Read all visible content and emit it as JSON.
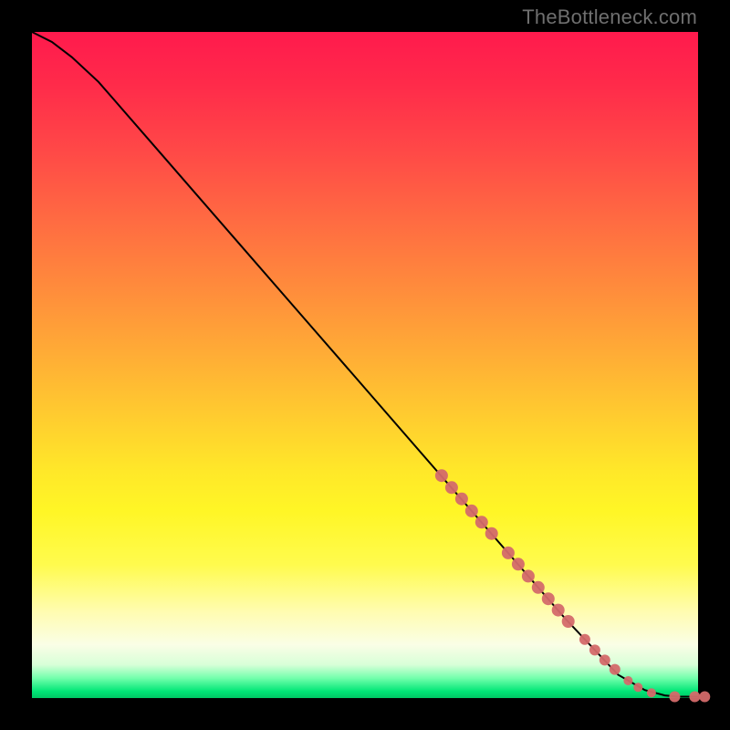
{
  "attribution": "TheBottleneck.com",
  "chart_data": {
    "type": "line",
    "title": "",
    "xlabel": "",
    "ylabel": "",
    "xlim": [
      0,
      100
    ],
    "ylim": [
      0,
      100
    ],
    "series": [
      {
        "name": "curve",
        "x": [
          0,
          3,
          6,
          10,
          20,
          30,
          40,
          50,
          60,
          70,
          80,
          88,
          92,
          95,
          97,
          100
        ],
        "y": [
          100,
          98.5,
          96.2,
          92.5,
          81,
          69.5,
          58,
          46.5,
          35,
          23.5,
          12,
          3.5,
          1.2,
          0.4,
          0.2,
          0.2
        ]
      }
    ],
    "markers": {
      "name": "data-points",
      "color": "#d46a6a",
      "points": [
        {
          "x": 61.5,
          "y": 33.4,
          "r": 7
        },
        {
          "x": 63.0,
          "y": 31.6,
          "r": 7
        },
        {
          "x": 64.5,
          "y": 29.9,
          "r": 7
        },
        {
          "x": 66.0,
          "y": 28.1,
          "r": 7
        },
        {
          "x": 67.5,
          "y": 26.4,
          "r": 7
        },
        {
          "x": 69.0,
          "y": 24.7,
          "r": 7
        },
        {
          "x": 71.5,
          "y": 21.8,
          "r": 7
        },
        {
          "x": 73.0,
          "y": 20.1,
          "r": 7
        },
        {
          "x": 74.5,
          "y": 18.3,
          "r": 7
        },
        {
          "x": 76.0,
          "y": 16.6,
          "r": 7
        },
        {
          "x": 77.5,
          "y": 14.9,
          "r": 7
        },
        {
          "x": 79.0,
          "y": 13.2,
          "r": 7
        },
        {
          "x": 80.5,
          "y": 11.5,
          "r": 7
        },
        {
          "x": 83.0,
          "y": 8.8,
          "r": 6
        },
        {
          "x": 84.5,
          "y": 7.2,
          "r": 6
        },
        {
          "x": 86.0,
          "y": 5.7,
          "r": 6
        },
        {
          "x": 87.5,
          "y": 4.3,
          "r": 6
        },
        {
          "x": 89.5,
          "y": 2.6,
          "r": 5
        },
        {
          "x": 91.0,
          "y": 1.6,
          "r": 5
        },
        {
          "x": 93.0,
          "y": 0.8,
          "r": 5
        },
        {
          "x": 96.5,
          "y": 0.2,
          "r": 6
        },
        {
          "x": 99.5,
          "y": 0.2,
          "r": 6
        },
        {
          "x": 101.0,
          "y": 0.2,
          "r": 6
        }
      ]
    }
  }
}
